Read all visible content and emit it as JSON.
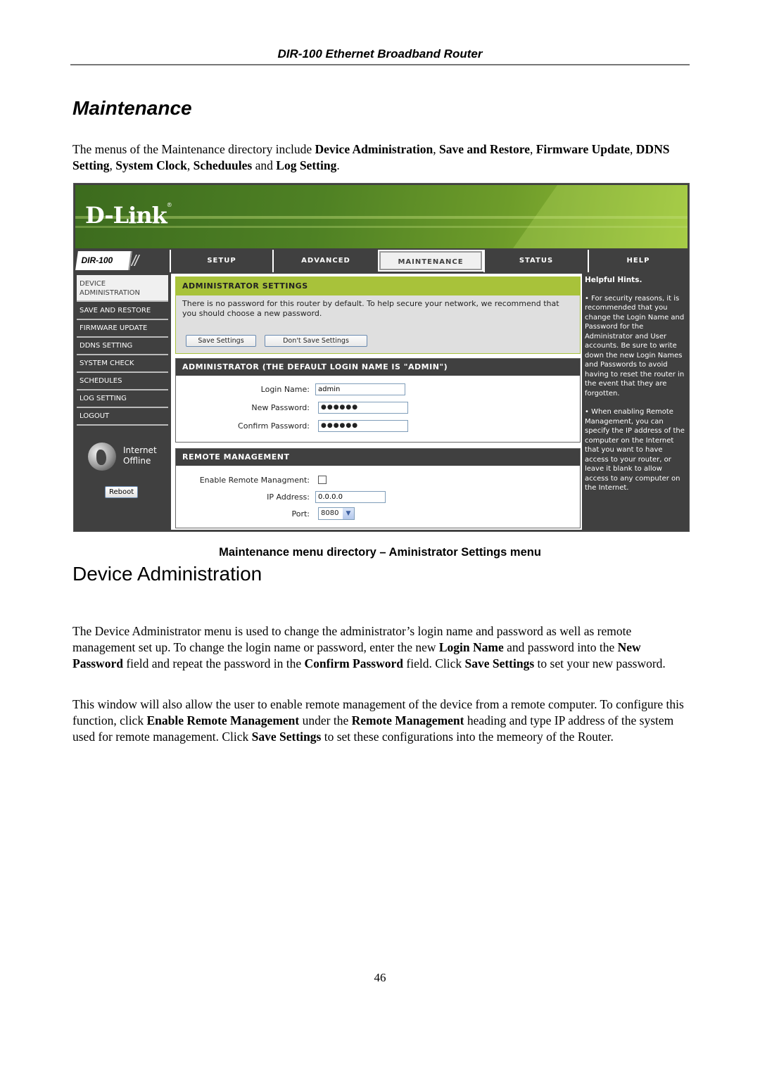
{
  "running_header": "DIR-100 Ethernet Broadband Router",
  "section_title": "Maintenance",
  "intro": {
    "t1": "The menus of the Maintenance directory include ",
    "b1": "Device Administration",
    "t2": ", ",
    "b2": "Save and Restore",
    "t3": ", ",
    "b3": "Firmware Update",
    "t4": ", ",
    "b4": "DDNS Setting",
    "t5": ", ",
    "b5": "System Clock",
    "t6": ", ",
    "b6": "Scheduules",
    "t7": " and ",
    "b7": "Log Setting",
    "t8": "."
  },
  "router_ui": {
    "brand": "D-Link",
    "model": "DIR-100",
    "tabs": [
      {
        "label": "SETUP",
        "active": false
      },
      {
        "label": "ADVANCED",
        "active": false
      },
      {
        "label": "MAINTENANCE",
        "active": true
      },
      {
        "label": "STATUS",
        "active": false
      },
      {
        "label": "HELP",
        "active": false
      }
    ],
    "sidebar": [
      {
        "label": "DEVICE ADMINISTRATION",
        "active": true
      },
      {
        "label": "SAVE AND RESTORE",
        "active": false
      },
      {
        "label": "FIRMWARE UPDATE",
        "active": false
      },
      {
        "label": "DDNS SETTING",
        "active": false
      },
      {
        "label": "SYSTEM CHECK",
        "active": false
      },
      {
        "label": "SCHEDULES",
        "active": false
      },
      {
        "label": "LOG SETTING",
        "active": false
      },
      {
        "label": "LOGOUT",
        "active": false
      }
    ],
    "internet_status": {
      "line1": "Internet",
      "line2": "Offline"
    },
    "reboot_label": "Reboot",
    "admin_settings": {
      "title": "ADMINISTRATOR SETTINGS",
      "description": "There is no password for this router by default. To help secure your network, we recommend that you should choose a new password.",
      "save_label": "Save Settings",
      "dont_save_label": "Don't Save Settings"
    },
    "administrator": {
      "title": "ADMINISTRATOR (THE DEFAULT LOGIN NAME IS \"ADMIN\")",
      "login_name_label": "Login Name:",
      "login_name_value": "admin",
      "new_password_label": "New Password:",
      "new_password_value": "●●●●●●",
      "confirm_password_label": "Confirm Password:",
      "confirm_password_value": "●●●●●●"
    },
    "remote_management": {
      "title": "REMOTE MANAGEMENT",
      "enable_label": "Enable Remote Managment:",
      "enable_checked": false,
      "ip_label": "IP Address:",
      "ip_value": "0.0.0.0",
      "port_label": "Port:",
      "port_value": "8080"
    },
    "hints": {
      "title": "Helpful Hints.",
      "items": [
        "• For security reasons, it is recommended that you change the Login Name and Password for the Administrator and User accounts. Be sure to write down the new Login Names and Passwords to avoid having to reset the router in the event that they are forgotten.",
        "• When enabling Remote Management, you can specify the IP address of the computer on the Internet that you want to have access to your router, or leave it blank to allow access to any computer on the Internet."
      ]
    },
    "colors": {
      "green": "#a8c23a",
      "dark": "#404040"
    }
  },
  "figure_caption": "Maintenance menu directory – Aministrator Settings menu",
  "subsection_title": "Device Administration",
  "para2": {
    "t1": "The Device Administrator menu is used to change the administrator’s  login name and password as well as remote management set up.  To change the login name or password, enter the new ",
    "b1": "Login Name",
    "t2": " and password into the ",
    "b2": "New Password",
    "t3": " field and repeat the password in the ",
    "b3": "Confirm Password",
    "t4": " field. Click ",
    "b4": "Save Settings",
    "t5": " to set your new password."
  },
  "para3": {
    "t1": "This window will also allow the user to enable remote management of the device from a remote computer. To configure this function, click ",
    "b1": "Enable Remote Management",
    "t2": " under the ",
    "b2": "Remote Management",
    "t3": " heading and type IP address of the system used for remote management. Click ",
    "b3": "Save Settings",
    "t4": " to set these configurations into the memeory of the Router."
  },
  "page_number": "46"
}
